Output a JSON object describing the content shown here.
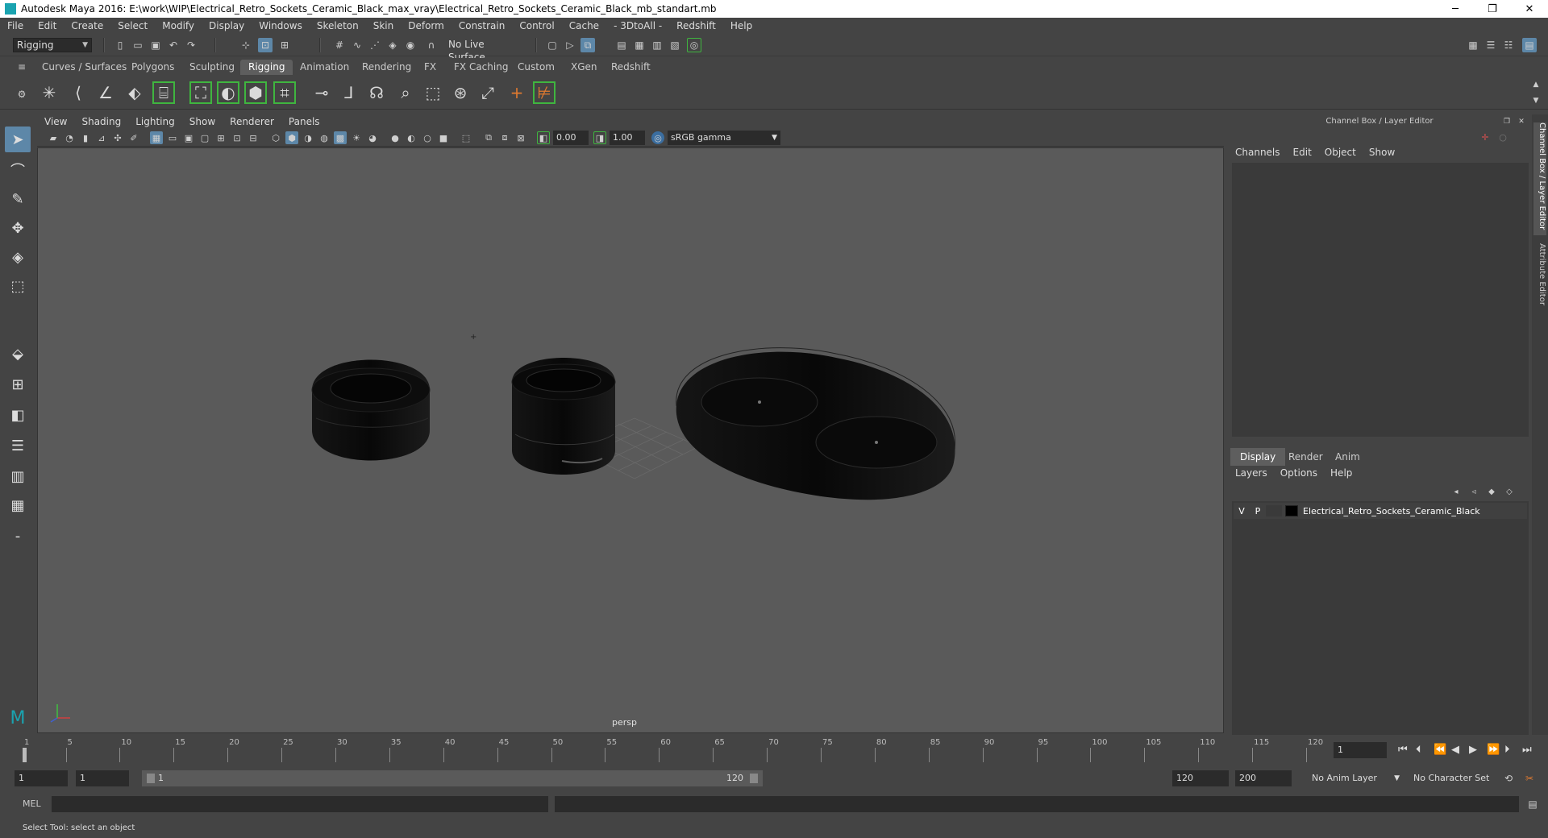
{
  "window": {
    "title": "Autodesk Maya 2016: E:\\work\\WIP\\Electrical_Retro_Sockets_Ceramic_Black_max_vray\\Electrical_Retro_Sockets_Ceramic_Black_mb_standart.mb",
    "minimize": "─",
    "restore": "❐",
    "close": "✕"
  },
  "menu": [
    "File",
    "Edit",
    "Create",
    "Select",
    "Modify",
    "Display",
    "Windows",
    "Skeleton",
    "Skin",
    "Deform",
    "Constrain",
    "Control",
    "Cache",
    "- 3DtoAll -",
    "Redshift",
    "Help"
  ],
  "statusline": {
    "mode": "Rigging",
    "live_surface": "No Live Surface"
  },
  "shelf": {
    "tabs": [
      "Curves / Surfaces",
      "Polygons",
      "Sculpting",
      "Rigging",
      "Animation",
      "Rendering",
      "FX",
      "FX Caching",
      "Custom",
      "XGen",
      "Redshift"
    ],
    "active": "Rigging"
  },
  "viewport": {
    "menu": [
      "View",
      "Shading",
      "Lighting",
      "Show",
      "Renderer",
      "Panels"
    ],
    "exposure": "0.00",
    "gamma": "1.00",
    "color_space": "sRGB gamma",
    "camera": "persp"
  },
  "channel_box": {
    "title": "Channel Box / Layer Editor",
    "menu": [
      "Channels",
      "Edit",
      "Object",
      "Show"
    ]
  },
  "layer_editor": {
    "tabs": [
      "Display",
      "Render",
      "Anim"
    ],
    "active_tab": "Display",
    "menu": [
      "Layers",
      "Options",
      "Help"
    ],
    "layer": {
      "v": "V",
      "p": "P",
      "name": "Electrical_Retro_Sockets_Ceramic_Black",
      "color": "#000000"
    }
  },
  "side_tabs": [
    "Channel Box / Layer Editor",
    "Attribute Editor"
  ],
  "timeline": {
    "ticks": [
      1,
      5,
      10,
      15,
      20,
      25,
      30,
      35,
      40,
      45,
      50,
      55,
      60,
      65,
      70,
      75,
      80,
      85,
      90,
      95,
      100,
      105,
      110,
      115,
      120
    ],
    "current_frame": "1"
  },
  "range": {
    "start": "1",
    "playback_start": "1",
    "slider_start": "1",
    "slider_end": "120",
    "playback_end": "120",
    "end": "200",
    "anim_layer": "No Anim Layer",
    "character_set": "No Character Set"
  },
  "cmdline": {
    "label": "MEL"
  },
  "help": "Select Tool: select an object",
  "colors": {
    "accent": "#5d87a8",
    "shelf_highlight": "#3fb53f",
    "viewport_bg": "#5a5a5a"
  }
}
